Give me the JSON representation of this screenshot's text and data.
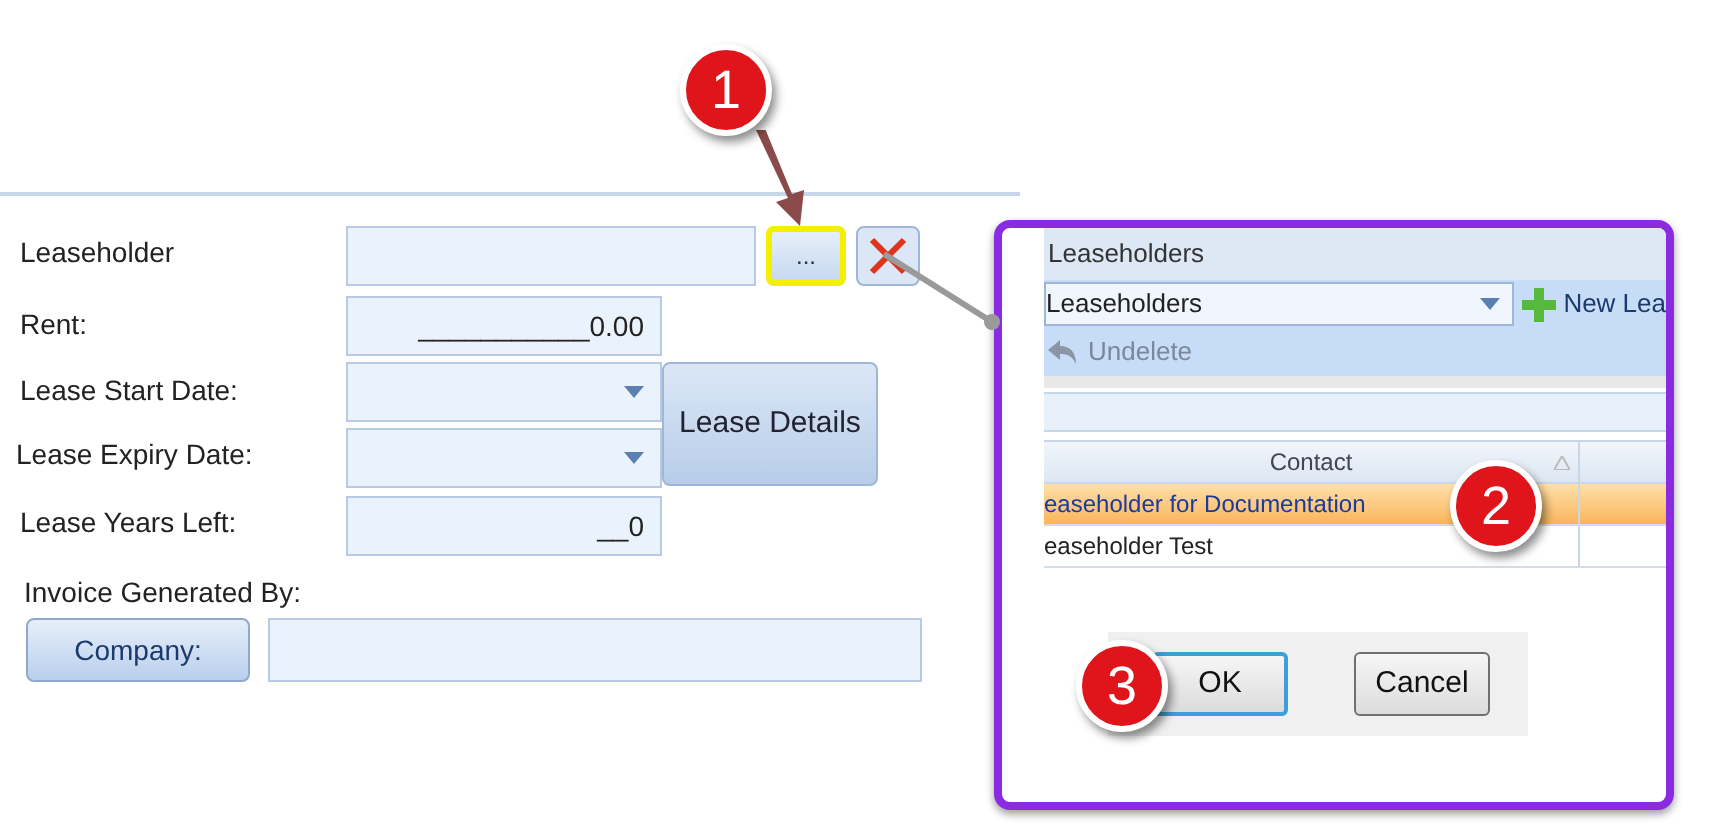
{
  "form": {
    "leaseholder": {
      "label": "Leaseholder",
      "browse_button": "...",
      "highlighted": true
    },
    "rent": {
      "label": "Rent:",
      "value": "___________0.00"
    },
    "start_date": {
      "label": "Lease Start Date:"
    },
    "expiry_date": {
      "label": "Lease Expiry Date:"
    },
    "years_left": {
      "label": "Lease Years Left:",
      "value": "__0"
    },
    "lease_details_button": "Lease Details",
    "invoice_label": "Invoice Generated By:",
    "company_button": "Company:"
  },
  "inset": {
    "title": "Leaseholders",
    "dropdown_value": "Leaseholders",
    "new_button": "New Lea",
    "undelete_button": "Undelete",
    "undelete_disabled": true,
    "columns": [
      "Contact"
    ],
    "rows": [
      {
        "contact": "easeholder for Documentation",
        "selected": true
      },
      {
        "contact": "easeholder Test",
        "selected": false
      }
    ],
    "buttons": [
      {
        "label": "OK",
        "focused": true
      },
      {
        "label": "Cancel",
        "focused": false
      }
    ]
  },
  "callouts": [
    "1",
    "2",
    "3"
  ]
}
